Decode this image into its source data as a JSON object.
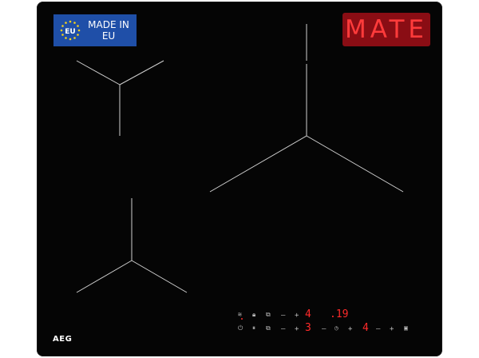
{
  "badges": {
    "eu_top": "MADE IN",
    "eu_bottom": "EU",
    "eu_flag_text": "EU",
    "mate": "MATE"
  },
  "brand": "AEG",
  "colors": {
    "panel": "#050505",
    "eu_blue": "#1f4fa8",
    "mate_bg": "#8a0d14",
    "mate_text": "#ff3b3b",
    "led_red": "#ff2a2a",
    "zone_lines": "#cfcfcf"
  },
  "controls": {
    "row1": {
      "hob2hood_icon": "hob2hood-icon",
      "lock_icon": "lock-icon",
      "zone_select_icon": "zone-select-icon",
      "minus": "–",
      "plus": "+",
      "level": "4",
      "timer": ".19"
    },
    "row2": {
      "power_icon": "power-icon",
      "pause_icon": "pause-icon",
      "bridge_icon": "bridge-icon",
      "minus_a": "–",
      "plus_a": "+",
      "level_a": "3",
      "minus_b": "–",
      "timer_icon": "timer-icon",
      "plus_b": "+",
      "level_b": "4",
      "minus_c": "–",
      "plus_c": "+",
      "zone_icon": "zone-icon"
    }
  }
}
